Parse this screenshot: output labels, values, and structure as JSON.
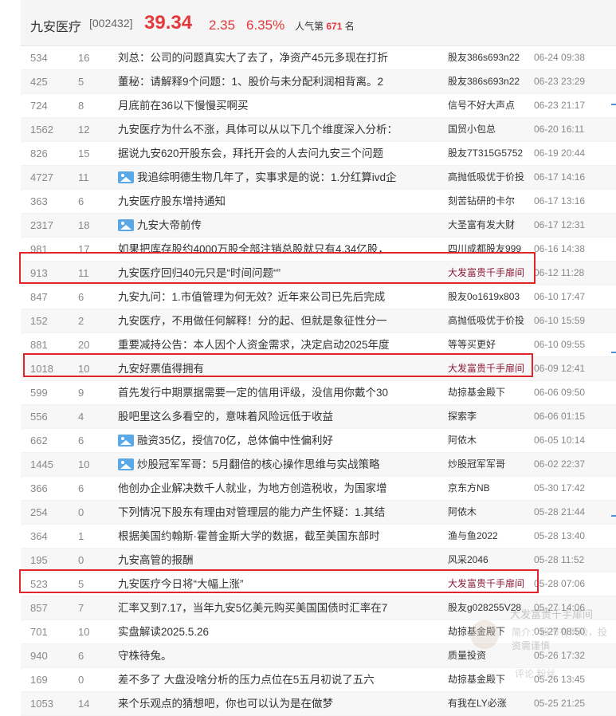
{
  "header": {
    "name": "九安医疗",
    "code": "[002432]",
    "price": "39.34",
    "change": "2.35",
    "change_pct": "6.35%",
    "popularity_label": "人气第",
    "popularity_rank": "671",
    "popularity_suffix": "名"
  },
  "posts": [
    {
      "reads": "534",
      "comments": "16",
      "title": "刘总：公司的问题真实大了去了，净资产45元多现在打折",
      "author": "股友386s693n22",
      "time": "06-24 09:38",
      "image": false
    },
    {
      "reads": "425",
      "comments": "5",
      "title": "董秘：请解释9个问题：1、股价与未分配利润相背离。2",
      "author": "股友386s693n22",
      "time": "06-23 23:29",
      "image": false
    },
    {
      "reads": "724",
      "comments": "8",
      "title": "月底前在36以下慢慢买啊买",
      "author": "信号不好大声点",
      "time": "06-23 21:17",
      "image": false
    },
    {
      "reads": "1562",
      "comments": "12",
      "title": "九安医疗为什么不涨，具体可以从以下几个维度深入分析：",
      "author": "国贸小包总",
      "time": "06-20 16:11",
      "image": false
    },
    {
      "reads": "826",
      "comments": "15",
      "title": "据说九安620开股东会，拜托开会的人去问九安三个问题",
      "author": "股友7T315G5752",
      "time": "06-19 20:44",
      "image": false
    },
    {
      "reads": "4727",
      "comments": "11",
      "title": "我追综明德生物几年了，实事求是的说：1.分红算ivd企",
      "author": "高抛低吸优于价投",
      "time": "06-17 14:16",
      "image": true
    },
    {
      "reads": "363",
      "comments": "6",
      "title": "九安医疗股东增持通知",
      "author": "刻苦钻研的卡尔",
      "time": "06-17 13:16",
      "image": false
    },
    {
      "reads": "2317",
      "comments": "18",
      "title": "九安大帝前传",
      "author": "大圣富有发大财",
      "time": "06-17 12:31",
      "image": true
    },
    {
      "reads": "981",
      "comments": "17",
      "title": "如果把库存股约4000万股全部注销总股就只有4.34亿股，",
      "author": "四川成都股友999",
      "time": "06-16 14:38",
      "image": false
    },
    {
      "reads": "913",
      "comments": "11",
      "title": "九安医疗回归40元只是“时间问题“”",
      "author": "大发富贵千手扉间",
      "time": "06-12 11:28",
      "image": false,
      "hot": true
    },
    {
      "reads": "847",
      "comments": "6",
      "title": "九安九问：1.市值管理为何无效？近年来公司已先后完成",
      "author": "股友0o1619x803",
      "time": "06-10 17:47",
      "image": false
    },
    {
      "reads": "152",
      "comments": "2",
      "title": "九安医疗，不用做任何解释！分的起、但就是象征性分一",
      "author": "高抛低吸优于价投",
      "time": "06-10 15:59",
      "image": false
    },
    {
      "reads": "881",
      "comments": "20",
      "title": "重要减持公告：本人因个人资金需求，决定启动2025年度",
      "author": "等等买更好",
      "time": "06-10 09:55",
      "image": false
    },
    {
      "reads": "1018",
      "comments": "10",
      "title": "九安好票值得拥有",
      "author": "大发富贵千手扉间",
      "time": "06-09 12:41",
      "image": false,
      "hot": true
    },
    {
      "reads": "599",
      "comments": "9",
      "title": "首先发行中期票据需要一定的信用评级，没信用你戴个30",
      "author": "劫掠基金殿下",
      "time": "06-06 09:50",
      "image": false
    },
    {
      "reads": "556",
      "comments": "4",
      "title": "股吧里这么多看空的，意味着风险远低于收益",
      "author": "探索李",
      "time": "06-06 01:15",
      "image": false
    },
    {
      "reads": "662",
      "comments": "6",
      "title": "融资35亿，授信70亿，总体偏中性偏利好",
      "author": "阿侬木",
      "time": "06-05 10:14",
      "image": true
    },
    {
      "reads": "1445",
      "comments": "10",
      "title": "炒股冠军军哥：5月翻倍的核心操作思维与实战策略",
      "author": "炒股冠军军哥",
      "time": "06-02 22:37",
      "image": true
    },
    {
      "reads": "366",
      "comments": "6",
      "title": "他创办企业解决数千人就业，为地方创造税收，为国家增",
      "author": "京东方NB",
      "time": "05-30 17:42",
      "image": false
    },
    {
      "reads": "254",
      "comments": "0",
      "title": "下列情况下股东有理由对管理层的能力产生怀疑：1.其结",
      "author": "阿侬木",
      "time": "05-28 21:44",
      "image": false
    },
    {
      "reads": "364",
      "comments": "1",
      "title": "根据美国约翰斯·霍普金斯大学的数据，截至美国东部时",
      "author": "渔与鱼2022",
      "time": "05-28 13:40",
      "image": false
    },
    {
      "reads": "195",
      "comments": "0",
      "title": "九安高管的报酬",
      "author": "风采2046",
      "time": "05-28 11:52",
      "image": false
    },
    {
      "reads": "523",
      "comments": "5",
      "title": "九安医疗今日将“大幅上涨”",
      "author": "大发富贵千手扉间",
      "time": "05-28 07:06",
      "image": false,
      "hot": true
    },
    {
      "reads": "857",
      "comments": "7",
      "title": "汇率又到7.17，当年九安5亿美元购买美国国债时汇率在7",
      "author": "股友g028255V28",
      "time": "05-27 14:06",
      "image": false
    },
    {
      "reads": "701",
      "comments": "10",
      "title": "实盘解读2025.5.26",
      "author": "劫掠基金殿下",
      "time": "05-27 08:50",
      "image": false
    },
    {
      "reads": "940",
      "comments": "6",
      "title": "守株待兔。",
      "author": "质量投资",
      "time": "05-26 17:32",
      "image": false
    },
    {
      "reads": "169",
      "comments": "0",
      "title": "差不多了 大盘没啥分析的压力点位在5五月初说了五六",
      "author": "劫掠基金殿下",
      "time": "05-26 13:45",
      "image": false
    },
    {
      "reads": "1053",
      "comments": "14",
      "title": "来个乐观点的猜想吧，你也可以认为是在做梦",
      "author": "有我在LY必涨",
      "time": "05-25 21:25",
      "image": false
    }
  ],
  "overlay": {
    "name": "大发富贵千手扉间",
    "intro": "简介：股市有风险，投资需谨慎",
    "stats": "评论 粉丝"
  },
  "colors": {
    "accent_red": "#e4393c",
    "highlight_box": "#e0262c",
    "hot_author": "#8b1a3a"
  }
}
